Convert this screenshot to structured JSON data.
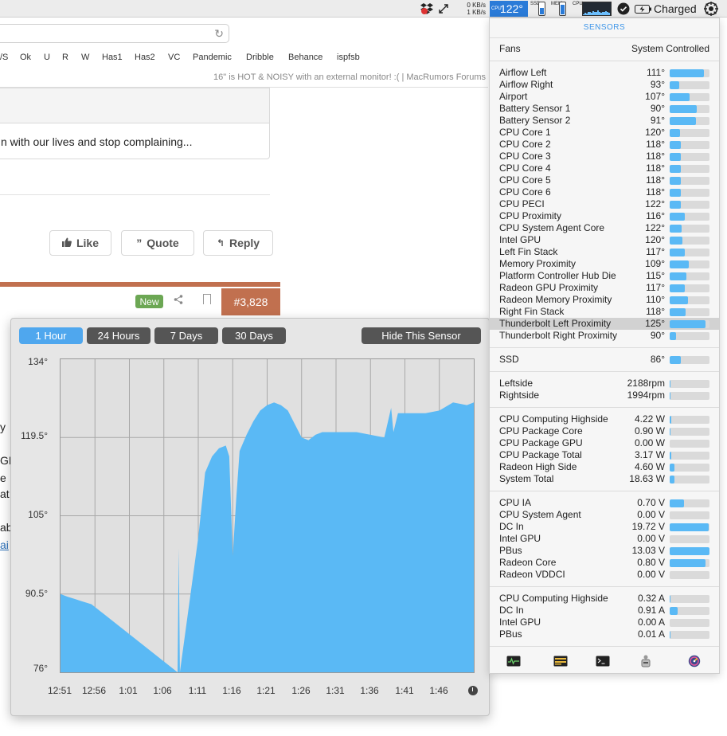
{
  "menubar": {
    "net_up": "0 KB/s",
    "net_down": "1 KB/s",
    "cpu_temp": "122°",
    "cpu_temp_label": "CPU",
    "ssd_label": "SSD",
    "mem_label": "MEM",
    "cpu_label": "CPU",
    "battery_status": "Charged",
    "ssd_level": 0.55,
    "mem_level": 0.85,
    "cpu_level": 0.3
  },
  "browser": {
    "bookmarks": [
      "/S",
      "Ok",
      "U",
      "R",
      "W",
      "Has1",
      "Has2",
      "VC",
      "Pandemic",
      "Dribble",
      "Behance",
      "ispfsb"
    ],
    "tab_title": "16\" is HOT & NOISY with an external monitor! :( | MacRumors Forums",
    "quote_text": "n with our lives and stop complaining...",
    "like_label": "Like",
    "quote_label": "Quote",
    "reply_label": "Reply",
    "new_badge": "New",
    "post_number": "#3,828",
    "left_fragments": [
      "y",
      "GP",
      "e",
      "at",
      "ab",
      "ai"
    ]
  },
  "graph": {
    "range_buttons": [
      "1 Hour",
      "24 Hours",
      "7 Days",
      "30 Days"
    ],
    "active_range": 0,
    "hide_button": "Hide This Sensor",
    "y_ticks": [
      "134°",
      "119.5°",
      "105°",
      "90.5°",
      "76°"
    ],
    "x_ticks": [
      "12:51",
      "12:56",
      "1:01",
      "1:06",
      "1:11",
      "1:16",
      "1:21",
      "1:26",
      "1:31",
      "1:36",
      "1:41",
      "1:46"
    ]
  },
  "chart_data": {
    "type": "area",
    "title": "",
    "xlabel": "",
    "ylabel": "",
    "ylim": [
      76,
      134
    ],
    "grid": true,
    "color": "#5ab9f5",
    "series": [
      {
        "x": [
          "12:51",
          "12:52",
          "12:53",
          "12:54",
          "12:55",
          "12:55:30",
          "1:08",
          "1:08:10",
          "1:08:20",
          "1:11",
          "1:12",
          "1:13",
          "1:14",
          "1:15",
          "1:15:30",
          "1:16",
          "1:16:30",
          "1:17",
          "1:18",
          "1:19",
          "1:20",
          "1:21",
          "1:22",
          "1:23",
          "1:24",
          "1:25",
          "1:26",
          "1:27",
          "1:28",
          "1:29",
          "1:30",
          "1:32",
          "1:34",
          "1:36",
          "1:38",
          "1:39",
          "1:39:20",
          "1:40",
          "1:42",
          "1:44",
          "1:46",
          "1:48",
          "1:50",
          "1:51"
        ],
        "values": [
          90.5,
          90.0,
          89.6,
          89.2,
          88.8,
          88.6,
          76,
          99.0,
          76,
          101.0,
          113.0,
          116.0,
          117.5,
          118.0,
          116.0,
          97.5,
          108.0,
          117.0,
          120.0,
          122.5,
          124.5,
          125.5,
          126.0,
          125.5,
          124.5,
          122.0,
          119.5,
          119.0,
          120.0,
          120.5,
          120.5,
          120.5,
          120.5,
          120.0,
          119.5,
          125.0,
          120.5,
          124.0,
          124.0,
          124.0,
          124.5,
          126.0,
          125.5,
          126.0
        ]
      }
    ]
  },
  "sensors": {
    "title": "SENSORS",
    "fans_label": "Fans",
    "fans_value": "System Controlled",
    "groups": [
      [
        {
          "name": "Airflow Left",
          "value": "111°",
          "level": 0.85
        },
        {
          "name": "Airflow Right",
          "value": "93°",
          "level": 0.24
        },
        {
          "name": "Airport",
          "value": "107°",
          "level": 0.5
        },
        {
          "name": "Battery Sensor 1",
          "value": "90°",
          "level": 0.68
        },
        {
          "name": "Battery Sensor 2",
          "value": "91°",
          "level": 0.65
        },
        {
          "name": "CPU Core 1",
          "value": "120°",
          "level": 0.26
        },
        {
          "name": "CPU Core 2",
          "value": "118°",
          "level": 0.27
        },
        {
          "name": "CPU Core 3",
          "value": "118°",
          "level": 0.27
        },
        {
          "name": "CPU Core 4",
          "value": "118°",
          "level": 0.27
        },
        {
          "name": "CPU Core 5",
          "value": "118°",
          "level": 0.27
        },
        {
          "name": "CPU Core 6",
          "value": "118°",
          "level": 0.27
        },
        {
          "name": "CPU PECI",
          "value": "122°",
          "level": 0.27
        },
        {
          "name": "CPU Proximity",
          "value": "116°",
          "level": 0.37
        },
        {
          "name": "CPU System Agent Core",
          "value": "122°",
          "level": 0.3
        },
        {
          "name": "Intel GPU",
          "value": "120°",
          "level": 0.32
        },
        {
          "name": "Left Fin Stack",
          "value": "117°",
          "level": 0.38
        },
        {
          "name": "Memory Proximity",
          "value": "109°",
          "level": 0.48
        },
        {
          "name": "Platform Controller Hub Die",
          "value": "115°",
          "level": 0.42
        },
        {
          "name": "Radeon GPU Proximity",
          "value": "117°",
          "level": 0.38
        },
        {
          "name": "Radeon Memory Proximity",
          "value": "110°",
          "level": 0.45
        },
        {
          "name": "Right Fin Stack",
          "value": "118°",
          "level": 0.4
        },
        {
          "name": "Thunderbolt Left Proximity",
          "value": "125°",
          "level": 0.9,
          "highlight": true
        },
        {
          "name": "Thunderbolt Right Proximity",
          "value": "90°",
          "level": 0.15
        }
      ],
      [
        {
          "name": "SSD",
          "value": "86°",
          "level": 0.28
        }
      ],
      [
        {
          "name": "Leftside",
          "value": "2188rpm",
          "level": 0.02
        },
        {
          "name": "Rightside",
          "value": "1994rpm",
          "level": 0.02
        }
      ],
      [
        {
          "name": "CPU Computing Highside",
          "value": "4.22 W",
          "level": 0.04
        },
        {
          "name": "CPU Package Core",
          "value": "0.90 W",
          "level": 0.02
        },
        {
          "name": "CPU Package GPU",
          "value": "0.00 W",
          "level": 0.0
        },
        {
          "name": "CPU Package Total",
          "value": "3.17 W",
          "level": 0.04
        },
        {
          "name": "Radeon High Side",
          "value": "4.60 W",
          "level": 0.12
        },
        {
          "name": "System Total",
          "value": "18.63 W",
          "level": 0.12
        }
      ],
      [
        {
          "name": "CPU IA",
          "value": "0.70 V",
          "level": 0.36
        },
        {
          "name": "CPU System Agent",
          "value": "0.00 V",
          "level": 0.0
        },
        {
          "name": "DC In",
          "value": "19.72 V",
          "level": 0.98
        },
        {
          "name": "Intel GPU",
          "value": "0.00 V",
          "level": 0.0
        },
        {
          "name": "PBus",
          "value": "13.03 V",
          "level": 1.0
        },
        {
          "name": "Radeon Core",
          "value": "0.80 V",
          "level": 0.9
        },
        {
          "name": "Radeon VDDCI",
          "value": "0.00 V",
          "level": 0.0
        }
      ],
      [
        {
          "name": "CPU Computing Highside",
          "value": "0.32 A",
          "level": 0.02
        },
        {
          "name": "DC In",
          "value": "0.91 A",
          "level": 0.2
        },
        {
          "name": "Intel GPU",
          "value": "0.00 A",
          "level": 0.0
        },
        {
          "name": "PBus",
          "value": "0.01 A",
          "level": 0.01
        }
      ]
    ],
    "toolbar": [
      "activity-monitor-icon",
      "console-icon",
      "terminal-icon",
      "system-info-icon",
      "disk-utility-icon"
    ]
  }
}
